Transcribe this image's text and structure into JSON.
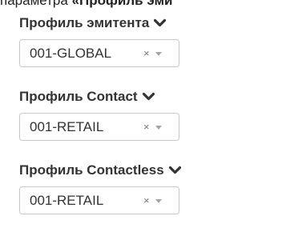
{
  "top_text": {
    "prefix": "параметра ",
    "bold": "«Профиль эми"
  },
  "fields": [
    {
      "label": "Профиль эмитента",
      "value": "001-GLOBAL",
      "clear": "×"
    },
    {
      "label": "Профиль Contact",
      "value": "001-RETAIL",
      "clear": "×"
    },
    {
      "label": "Профиль Contactless",
      "value": "001-RETAIL",
      "clear": "×"
    }
  ],
  "icons": {
    "label_toggle": "chevron-down-icon",
    "dropdown": "caret-down-icon",
    "clear": "clear-icon"
  },
  "colors": {
    "label_text": "#333333",
    "value_text": "#333333",
    "border": "#c9c9c9",
    "icon_gray": "#7a7a7a"
  }
}
